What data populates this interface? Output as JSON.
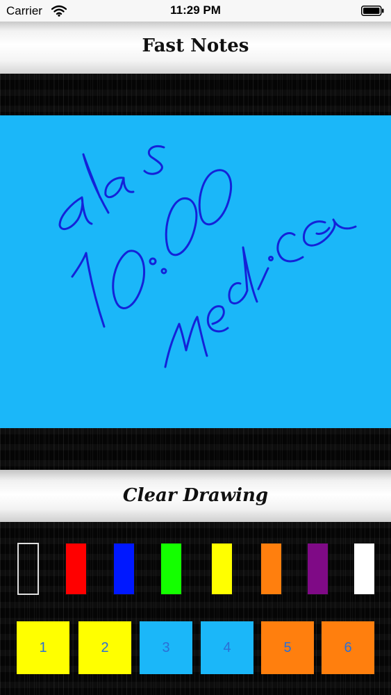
{
  "status_bar": {
    "carrier": "Carrier",
    "time": "11:29 PM"
  },
  "header": {
    "title": "Fast Notes"
  },
  "drawing": {
    "background_color": "#1bb7f9",
    "ink_color": "#1422d8",
    "handwritten_text": "a las 10:00 Medica"
  },
  "toolbar": {
    "clear_label": "Clear Drawing"
  },
  "palette": {
    "colors": [
      {
        "name": "black",
        "hex": "#000000"
      },
      {
        "name": "red",
        "hex": "#ff0000"
      },
      {
        "name": "blue",
        "hex": "#0018ff"
      },
      {
        "name": "green",
        "hex": "#14ff00"
      },
      {
        "name": "yellow",
        "hex": "#ffff00"
      },
      {
        "name": "orange",
        "hex": "#ff7f0e"
      },
      {
        "name": "purple",
        "hex": "#7f0a86"
      },
      {
        "name": "white",
        "hex": "#ffffff"
      }
    ],
    "sizes": [
      {
        "label": "1",
        "color": "#ffff00"
      },
      {
        "label": "2",
        "color": "#ffff00"
      },
      {
        "label": "3",
        "color": "#1bb7f9"
      },
      {
        "label": "4",
        "color": "#1bb7f9"
      },
      {
        "label": "5",
        "color": "#ff7f0e"
      },
      {
        "label": "6",
        "color": "#ff7f0e"
      }
    ]
  }
}
